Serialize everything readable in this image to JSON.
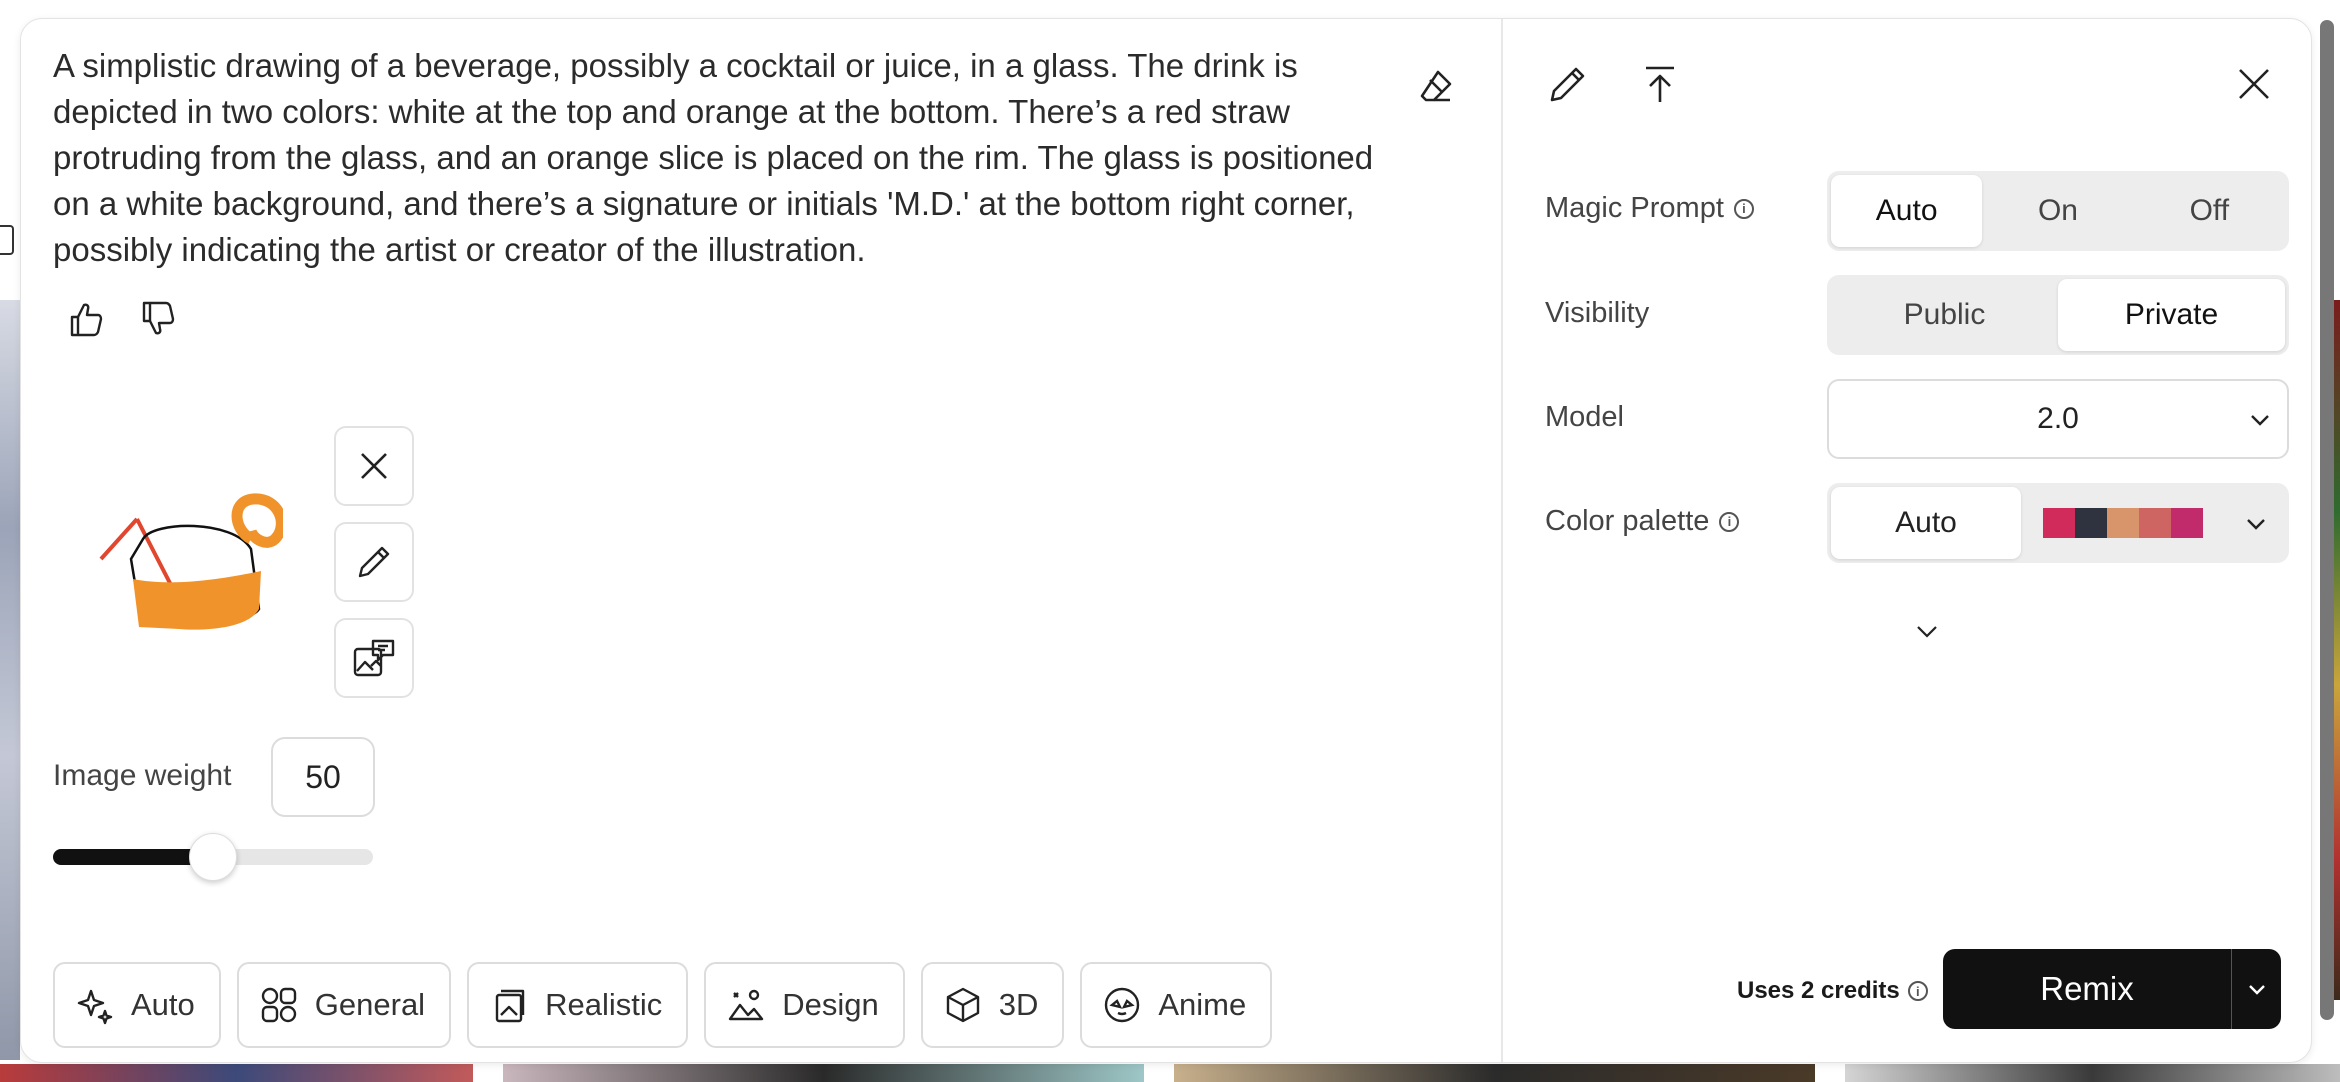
{
  "prompt": {
    "text": "A simplistic drawing of a beverage, possibly a cocktail or juice, in a glass. The drink is depicted in two colors: white at the top and orange at the bottom. There’s a red straw protruding from the glass, and an orange slice is placed on the rim. The glass is positioned on a white background, and there’s a signature or initials 'M.D.' at the bottom right corner, possibly indicating the artist or creator of the illustration."
  },
  "image_weight": {
    "label": "Image weight",
    "value": "50",
    "slider_fraction": 0.5
  },
  "styles": [
    {
      "label": "Auto",
      "icon": "sparkle-icon",
      "active": true
    },
    {
      "label": "General",
      "icon": "grid-icon",
      "active": false
    },
    {
      "label": "Realistic",
      "icon": "photo-stack-icon",
      "active": false
    },
    {
      "label": "Design",
      "icon": "design-icon",
      "active": false
    },
    {
      "label": "3D",
      "icon": "cube-icon",
      "active": false
    },
    {
      "label": "Anime",
      "icon": "anime-face-icon",
      "active": false
    }
  ],
  "settings": {
    "magic_prompt": {
      "label": "Magic Prompt",
      "options": [
        "Auto",
        "On",
        "Off"
      ],
      "selected": "Auto"
    },
    "visibility": {
      "label": "Visibility",
      "options": [
        "Public",
        "Private"
      ],
      "selected": "Private"
    },
    "model": {
      "label": "Model",
      "value": "2.0"
    },
    "color_palette": {
      "label": "Color palette",
      "value": "Auto",
      "swatches": [
        "#d12b5b",
        "#2f3340",
        "#d8946b",
        "#cf6563",
        "#c12a6b"
      ]
    }
  },
  "footer": {
    "credits": "Uses 2 credits",
    "remix_label": "Remix"
  },
  "colors": {
    "accent_orange": "#f0932b",
    "straw_red": "#e1462e",
    "button_dark": "#111111"
  }
}
